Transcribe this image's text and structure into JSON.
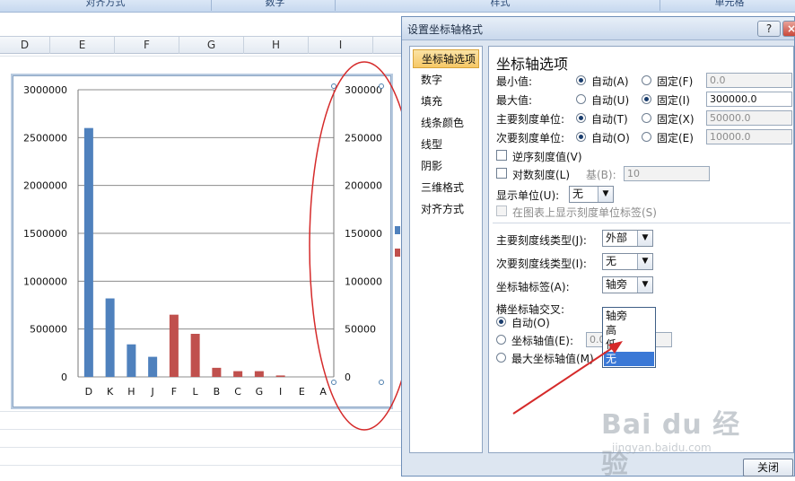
{
  "ribbon": {
    "groups": [
      "对齐方式",
      "数字",
      "样式",
      "单元格"
    ]
  },
  "sheet": {
    "columns": [
      "D",
      "E",
      "F",
      "G",
      "H",
      "I"
    ]
  },
  "chart_data": {
    "type": "bar",
    "categories": [
      "D",
      "K",
      "H",
      "J",
      "F",
      "L",
      "B",
      "C",
      "G",
      "I",
      "E",
      "A"
    ],
    "series": [
      {
        "name": "",
        "color": "#4f81bd",
        "values": [
          2600000,
          820000,
          340000,
          210000,
          0,
          0,
          0,
          0,
          0,
          0,
          0,
          0
        ]
      },
      {
        "name": "",
        "color": "#c0504d",
        "axis": "secondary",
        "values": [
          0,
          0,
          0,
          0,
          65000,
          45000,
          9500,
          6000,
          6000,
          1500,
          0,
          0
        ]
      }
    ],
    "primary_axis": {
      "ylim": [
        0,
        3000000
      ],
      "ticks": [
        "3000000",
        "2500000",
        "2000000",
        "1500000",
        "1000000",
        "500000",
        "0"
      ]
    },
    "secondary_axis": {
      "ylim": [
        0,
        300000
      ],
      "ticks": [
        "300000",
        "250000",
        "200000",
        "150000",
        "100000",
        "50000",
        "0"
      ]
    },
    "grid": true,
    "title": "",
    "xlabel": "",
    "ylabel": ""
  },
  "dialog": {
    "title": "设置坐标轴格式",
    "help_label": "?",
    "close_x_label": "×",
    "nav": [
      "坐标轴选项",
      "数字",
      "填充",
      "线条颜色",
      "线型",
      "阴影",
      "三维格式",
      "对齐方式"
    ],
    "section_title": "坐标轴选项",
    "rows": [
      {
        "label": "最小值:",
        "auto": "自动(A)",
        "fixed": "固定(F)",
        "value": "0.0",
        "selected": "auto"
      },
      {
        "label": "最大值:",
        "auto": "自动(U)",
        "fixed": "固定(I)",
        "value": "300000.0",
        "selected": "fixed"
      },
      {
        "label": "主要刻度单位:",
        "auto": "自动(T)",
        "fixed": "固定(X)",
        "value": "50000.0",
        "selected": "auto"
      },
      {
        "label": "次要刻度单位:",
        "auto": "自动(O)",
        "fixed": "固定(E)",
        "value": "10000.0",
        "selected": "auto"
      }
    ],
    "reverse_label": "逆序刻度值(V)",
    "log_label": "对数刻度(L)",
    "log_base_label": "基(B):",
    "log_base_value": "10",
    "display_units_label": "显示单位(U):",
    "display_units_value": "无",
    "show_units_label": "在图表上显示刻度单位标签(S)",
    "major_tick_label": "主要刻度线类型(J):",
    "major_tick_value": "外部",
    "minor_tick_label": "次要刻度线类型(I):",
    "minor_tick_value": "无",
    "axis_labels_label": "坐标轴标签(A):",
    "axis_labels_value": "轴旁",
    "dropdown_options": [
      "轴旁",
      "高",
      "低",
      "无"
    ],
    "cross_label": "横坐标轴交叉:",
    "cross_auto": "自动(O)",
    "cross_value_label": "坐标轴值(E):",
    "cross_value": "0.0",
    "cross_max": "最大坐标轴值(M)",
    "close_button": "关闭"
  },
  "watermark": {
    "text": "Bai du 经验",
    "url": "jingyan.baidu.com"
  }
}
